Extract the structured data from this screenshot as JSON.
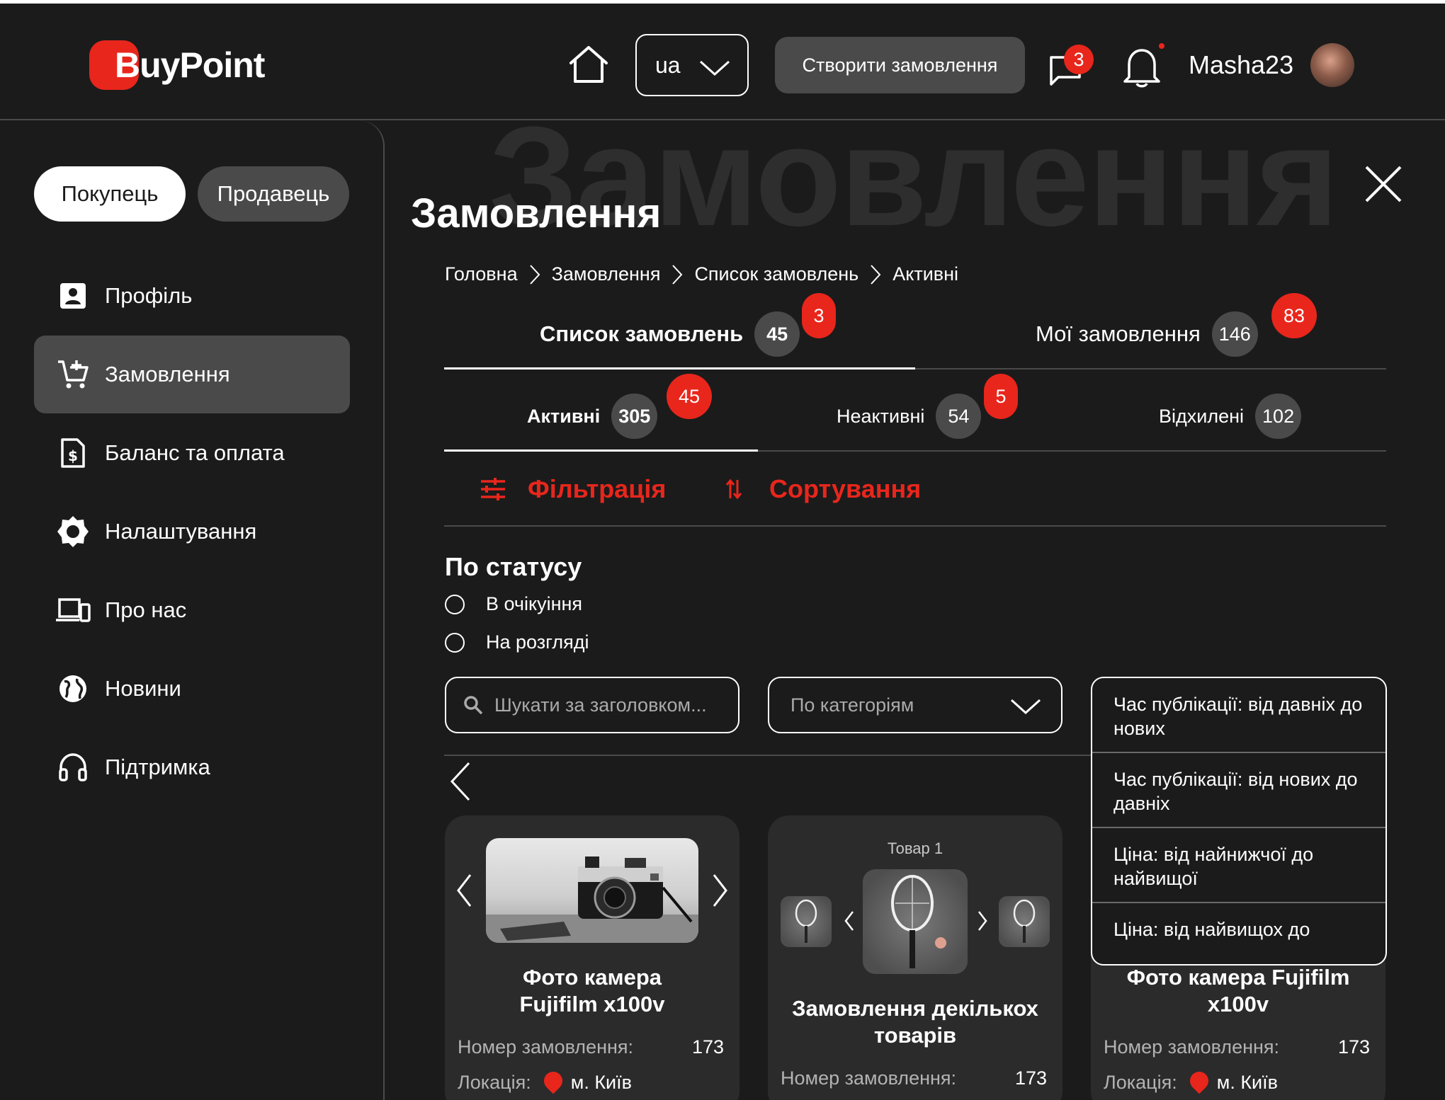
{
  "header": {
    "brand": "BuyPoint",
    "language": "ua",
    "create_order": "Створити замовлення",
    "messages_badge": "3",
    "username": "Masha23"
  },
  "sidebar": {
    "role_buyer": "Покупець",
    "role_seller": "Продавець",
    "items": [
      {
        "label": "Профіль",
        "icon": "profile-icon"
      },
      {
        "label": "Замовлення",
        "icon": "cart-icon",
        "active": true
      },
      {
        "label": "Баланс та оплата",
        "icon": "invoice-icon"
      },
      {
        "label": "Налаштування",
        "icon": "gear-icon"
      },
      {
        "label": "Про нас",
        "icon": "devices-icon"
      },
      {
        "label": "Новини",
        "icon": "globe-icon"
      },
      {
        "label": "Підтримка",
        "icon": "headset-icon"
      }
    ]
  },
  "main": {
    "watermark": "Замовлення",
    "title": "Замовлення",
    "breadcrumb": [
      "Головна",
      "Замовлення",
      "Список замовлень",
      "Активні"
    ],
    "tabs": [
      {
        "label": "Список замовлень",
        "count": "45",
        "badge": "3"
      },
      {
        "label": "Мої замовлення",
        "count": "146",
        "badge": "83"
      }
    ],
    "subtabs": [
      {
        "label": "Активні",
        "count": "305",
        "badge": "45"
      },
      {
        "label": "Неактивні",
        "count": "54",
        "badge": "5"
      },
      {
        "label": "Відхилені",
        "count": "102"
      }
    ],
    "filter_label": "Фільтрація",
    "sort_label": "Сортування",
    "status_title": "По статусу",
    "status_options": [
      "В очікуіння",
      "На розгляді"
    ],
    "search_placeholder": "Шукати за заголовком...",
    "category_placeholder": "По категоріям",
    "sort_options": [
      "Час публікації: від давніх до нових",
      "Час публікації: від нових до давніх",
      "Ціна: від найнижчої до найвищої",
      "Ціна: від найвищох до"
    ],
    "cards": [
      {
        "title": "Фото камера Fujifilm x100v",
        "order_label": "Номер замовлення:",
        "order_number": "173",
        "location_label": "Локація:",
        "location": "м. Київ"
      },
      {
        "caption": "Товар 1",
        "title": "Замовлення декількох товарів",
        "order_label": "Номер замовлення:",
        "order_number": "173"
      },
      {
        "title": "Фото камера  Fujifilm x100v",
        "order_label": "Номер замовлення:",
        "order_number": "173",
        "location_label": "Локація:",
        "location": "м. Київ"
      }
    ]
  },
  "colors": {
    "accent": "#e8261c",
    "background": "#1b1b1b",
    "surface": "#2b2b2b",
    "pill": "#4a4a4a"
  }
}
